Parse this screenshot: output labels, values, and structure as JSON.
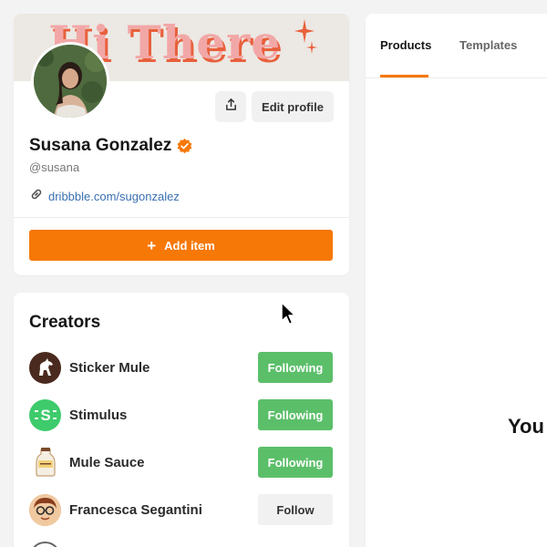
{
  "profile": {
    "banner_text": "Hi There",
    "name": "Susana Gonzalez",
    "handle": "@susana",
    "link": "dribbble.com/sugonzalez",
    "edit_label": "Edit profile",
    "add_item_label": "Add item",
    "icons": {
      "share": "share-icon",
      "verified": "verified-badge-icon",
      "link": "link-icon",
      "plus": "plus-icon"
    }
  },
  "creators": {
    "title": "Creators",
    "items": [
      {
        "name": "Sticker Mule",
        "button": "Following",
        "following": true,
        "avatar_icon": "horse-icon",
        "avatar_color": "#4a2a1e"
      },
      {
        "name": "Stimulus",
        "button": "Following",
        "following": true,
        "avatar_icon": "stimulus-logo-icon",
        "avatar_color": "#3ecb6b"
      },
      {
        "name": "Mule Sauce",
        "button": "Following",
        "following": true,
        "avatar_icon": "mule-sauce-logo-icon",
        "avatar_color": "#f5efe3"
      },
      {
        "name": "Francesca Segantini",
        "button": "Follow",
        "following": false,
        "avatar_icon": "person-avatar-icon",
        "avatar_color": "#e7a26a"
      }
    ]
  },
  "tabs": [
    {
      "label": "Products",
      "active": true
    },
    {
      "label": "Templates",
      "active": false
    }
  ],
  "right_heading": "You",
  "colors": {
    "accent": "#f67807",
    "following": "#5bbf6a",
    "link": "#3a6fb0",
    "page_bg": "#f3f3f4"
  }
}
